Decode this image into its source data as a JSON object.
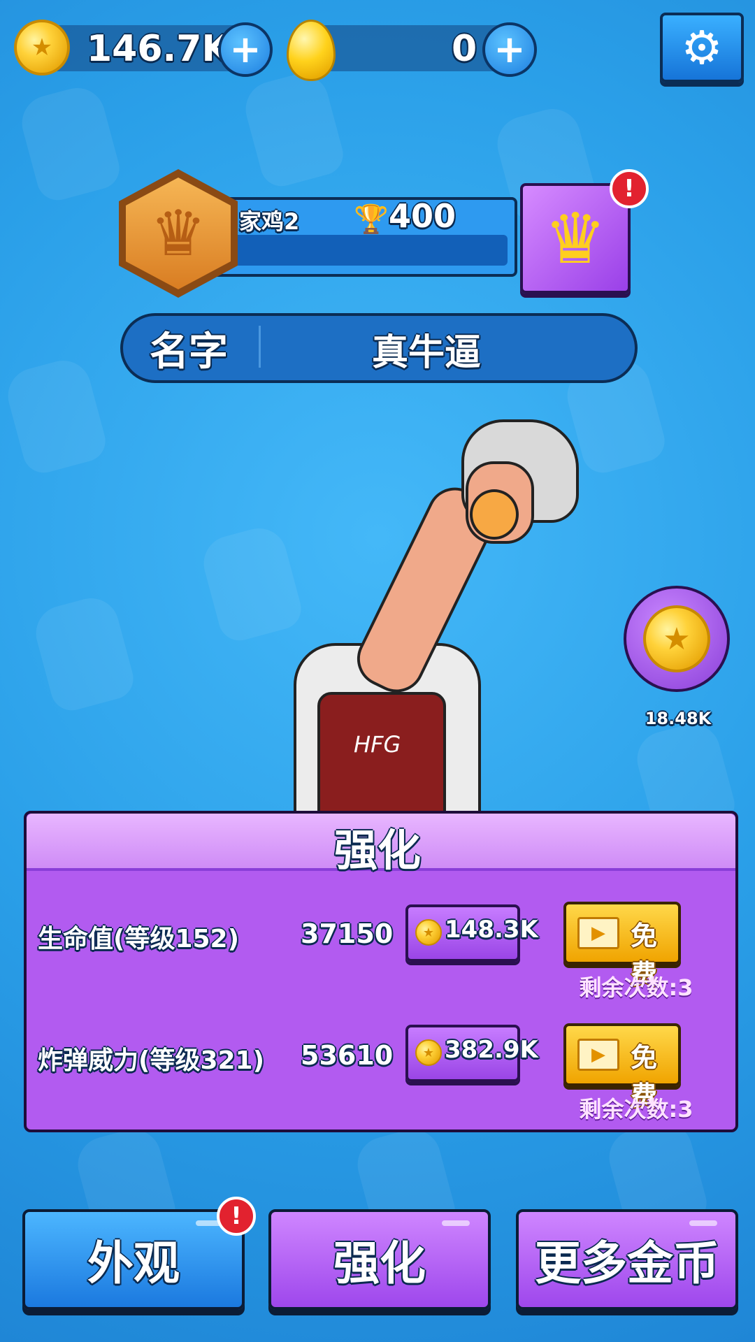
{
  "top_bar": {
    "coins_value": "146.7K",
    "gems_value": "0",
    "plus_glyph": "+"
  },
  "player": {
    "level_name": "家鸡2",
    "trophies": "400",
    "progress_fraction": 0.05,
    "name_label": "名字",
    "name_value": "真牛逼"
  },
  "side_reward": {
    "value": "18.48K"
  },
  "upgrade_panel": {
    "title": "强化",
    "rows": [
      {
        "label": "生命值(等级152)",
        "value": "37150",
        "cost": "148.3K",
        "free_label": "免费",
        "remaining": "剩余次数:3"
      },
      {
        "label": "炸弹威力(等级321)",
        "value": "53610",
        "cost": "382.9K",
        "free_label": "免费",
        "remaining": "剩余次数:3"
      }
    ]
  },
  "bottom_nav": {
    "appearance": "外观",
    "upgrade": "强化",
    "more_coins": "更多金币"
  },
  "icons": {
    "settings": "gear-icon",
    "trophy": "trophy-icon",
    "crown": "crown-icon",
    "alert": "!",
    "video": "video-icon"
  },
  "colors": {
    "background": "#2a9fe8",
    "panel_purple": "#b25bf0",
    "free_button": "#ffc21a",
    "alert_red": "#e2222f"
  }
}
